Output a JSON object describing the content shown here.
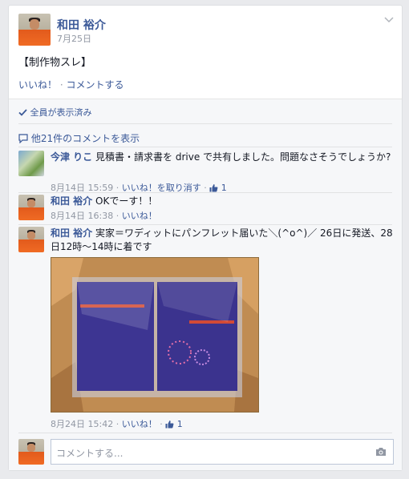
{
  "post": {
    "author": "和田 裕介",
    "date": "7月25日",
    "body": "【制作物スレ】",
    "like_label": "いいね！",
    "dot": "·",
    "comment_label": "コメントする"
  },
  "seen_by": "全員が表示済み",
  "view_more": "他21件のコメントを表示",
  "comments": [
    {
      "author": "今津 りこ",
      "text": "見積書・請求書を drive で共有しました。問題なさそうでしょうか?",
      "time": "8月14日 15:59",
      "action": "いいね！を取り消す",
      "likes": "1"
    },
    {
      "author": "和田 裕介",
      "text": "OKでーす！！",
      "time": "8月14日 16:38",
      "action": "いいね！"
    },
    {
      "author": "和田 裕介",
      "text": "実家＝ワディットにパンフレット届いた＼(^o^)／ 26日に発送、28日12時〜14時に着です",
      "time": "8月24日 15:42",
      "action": "いいね！",
      "likes": "1"
    }
  ],
  "compose": {
    "placeholder": "コメントする..."
  },
  "colors": {
    "link": "#3b5998",
    "meta": "#9197a3",
    "background": "#e9eaed"
  }
}
